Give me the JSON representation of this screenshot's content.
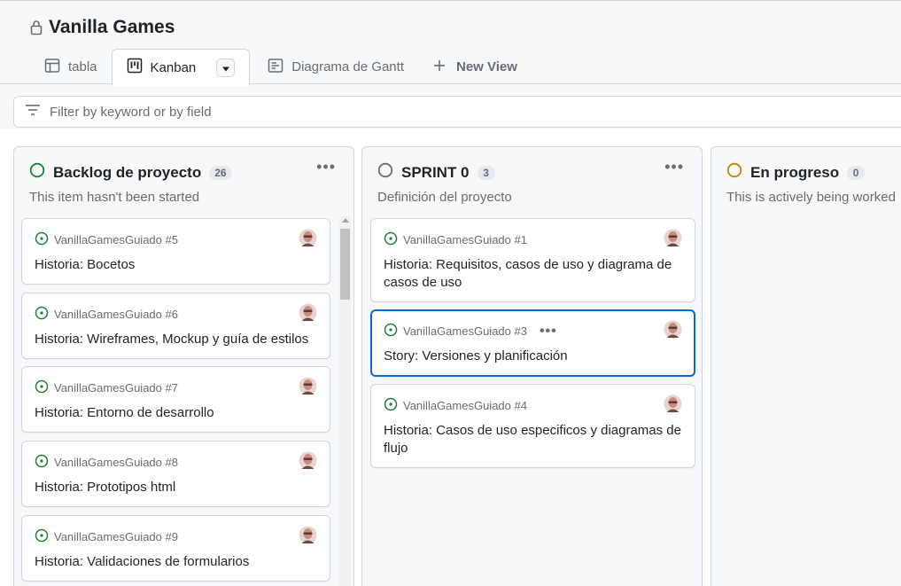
{
  "project": {
    "title": "Vanilla Games"
  },
  "views": [
    {
      "label": "tabla",
      "icon": "table-icon"
    },
    {
      "label": "Kanban",
      "icon": "kanban-icon",
      "active": true
    },
    {
      "label": "Diagrama de Gantt",
      "icon": "roadmap-icon"
    }
  ],
  "new_view_label": "New View",
  "filter": {
    "placeholder": "Filter by keyword or by field",
    "value": ""
  },
  "colors": {
    "accent": "#0969da",
    "open_issue": "#1a7f37",
    "todo_status": "#1a7f37",
    "sprint_status": "#656d76",
    "progress_status": "#bf8700"
  },
  "columns": [
    {
      "name": "Backlog de proyecto",
      "count": "26",
      "description": "This item hasn't been started",
      "status_icon": "circle-green-icon",
      "cards": [
        {
          "ref": "VanillaGamesGuiado #5",
          "title": "Historia: Bocetos"
        },
        {
          "ref": "VanillaGamesGuiado #6",
          "title": "Historia: Wireframes, Mockup y guía de estilos"
        },
        {
          "ref": "VanillaGamesGuiado #7",
          "title": "Historia: Entorno de desarrollo"
        },
        {
          "ref": "VanillaGamesGuiado #8",
          "title": "Historia: Prototipos html"
        },
        {
          "ref": "VanillaGamesGuiado #9",
          "title": "Historia: Validaciones de formularios"
        }
      ]
    },
    {
      "name": "SPRINT 0",
      "count": "3",
      "description": "Definición del proyecto",
      "status_icon": "circle-gray-icon",
      "cards": [
        {
          "ref": "VanillaGamesGuiado #1",
          "title": "Historia: Requisitos, casos de uso y diagrama de casos de uso"
        },
        {
          "ref": "VanillaGamesGuiado #3",
          "title": "Story: Versiones y planificación",
          "selected": true
        },
        {
          "ref": "VanillaGamesGuiado #4",
          "title": "Historia: Casos de uso especificos y diagramas de flujo"
        }
      ]
    },
    {
      "name": "En progreso",
      "count": "0",
      "description": "This is actively being worked",
      "status_icon": "circle-yellow-icon",
      "cards": []
    }
  ]
}
